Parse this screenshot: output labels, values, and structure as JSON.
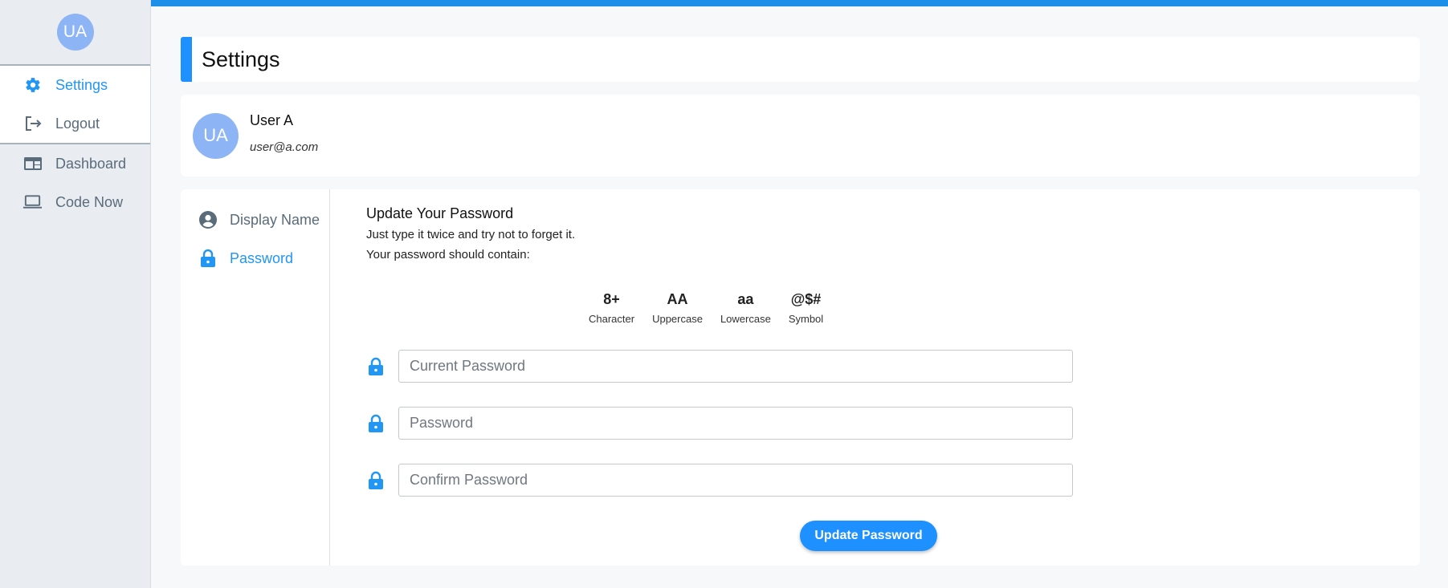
{
  "sidebar": {
    "avatar_initials": "UA",
    "primary_items": [
      {
        "label": "Settings",
        "icon": "gear-icon",
        "active": true
      },
      {
        "label": "Logout",
        "icon": "logout-icon",
        "active": false
      }
    ],
    "secondary_items": [
      {
        "label": "Dashboard",
        "icon": "dashboard-icon"
      },
      {
        "label": "Code Now",
        "icon": "laptop-icon"
      }
    ]
  },
  "page": {
    "title": "Settings"
  },
  "user": {
    "initials": "UA",
    "name": "User A",
    "email": "user@a.com"
  },
  "submenu": [
    {
      "label": "Display Name",
      "icon": "account-circle-icon",
      "active": false
    },
    {
      "label": "Password",
      "icon": "lock-icon",
      "active": true
    }
  ],
  "password_form": {
    "heading": "Update Your Password",
    "line1": "Just type it twice and try not to forget it.",
    "line2": "Your password should contain:",
    "requirements": [
      {
        "value": "8+",
        "label": "Character"
      },
      {
        "value": "AA",
        "label": "Uppercase"
      },
      {
        "value": "aa",
        "label": "Lowercase"
      },
      {
        "value": "@$#",
        "label": "Symbol"
      }
    ],
    "fields": {
      "current_placeholder": "Current Password",
      "new_placeholder": "Password",
      "confirm_placeholder": "Confirm Password"
    },
    "submit_label": "Update Password"
  },
  "colors": {
    "accent": "#1e90ff",
    "active_text": "#2196f3",
    "avatar": "#8db4f5",
    "sidebar_bg": "#e9edf1"
  }
}
